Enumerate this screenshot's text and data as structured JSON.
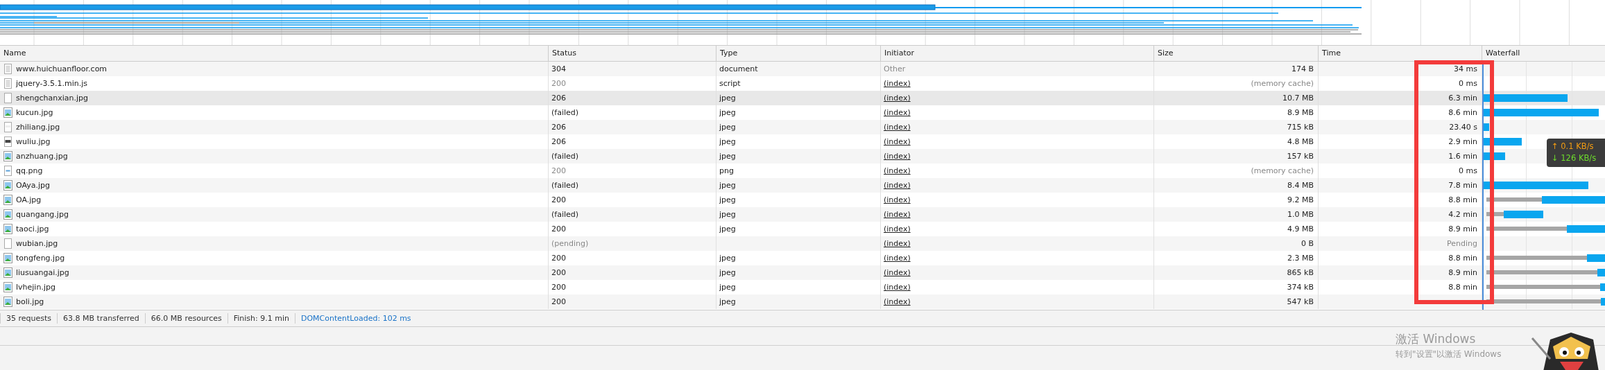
{
  "table": {
    "columns": [
      "Name",
      "Status",
      "Type",
      "Initiator",
      "Size",
      "Time",
      "Waterfall"
    ],
    "rows": [
      {
        "name": "www.huichuanfloor.com",
        "status": "304",
        "status_muted": false,
        "type": "document",
        "initiator": "Other",
        "initiator_link": false,
        "size": "174 B",
        "size_muted": false,
        "time": "34 ms",
        "time_muted": false,
        "selected": false
      },
      {
        "name": "jquery-3.5.1.min.js",
        "status": "200",
        "status_muted": true,
        "type": "script",
        "initiator": "(index)",
        "initiator_link": true,
        "size": "(memory cache)",
        "size_muted": true,
        "time": "0 ms",
        "time_muted": false,
        "selected": false
      },
      {
        "name": "shengchanxian.jpg",
        "status": "206",
        "status_muted": false,
        "type": "jpeg",
        "initiator": "(index)",
        "initiator_link": true,
        "size": "10.7 MB",
        "size_muted": false,
        "time": "6.3 min",
        "time_muted": false,
        "selected": true
      },
      {
        "name": "kucun.jpg",
        "status": "(failed)",
        "status_muted": false,
        "type": "jpeg",
        "initiator": "(index)",
        "initiator_link": true,
        "size": "8.9 MB",
        "size_muted": false,
        "time": "8.6 min",
        "time_muted": false,
        "selected": false
      },
      {
        "name": "zhiliang.jpg",
        "status": "206",
        "status_muted": false,
        "type": "jpeg",
        "initiator": "(index)",
        "initiator_link": true,
        "size": "715 kB",
        "size_muted": false,
        "time": "23.40 s",
        "time_muted": false,
        "selected": false
      },
      {
        "name": "wuliu.jpg",
        "status": "206",
        "status_muted": false,
        "type": "jpeg",
        "initiator": "(index)",
        "initiator_link": true,
        "size": "4.8 MB",
        "size_muted": false,
        "time": "2.9 min",
        "time_muted": false,
        "selected": false
      },
      {
        "name": "anzhuang.jpg",
        "status": "(failed)",
        "status_muted": false,
        "type": "jpeg",
        "initiator": "(index)",
        "initiator_link": true,
        "size": "157 kB",
        "size_muted": false,
        "time": "1.6 min",
        "time_muted": false,
        "selected": false
      },
      {
        "name": "qq.png",
        "status": "200",
        "status_muted": true,
        "type": "png",
        "initiator": "(index)",
        "initiator_link": true,
        "size": "(memory cache)",
        "size_muted": true,
        "time": "0 ms",
        "time_muted": false,
        "selected": false
      },
      {
        "name": "OAya.jpg",
        "status": "(failed)",
        "status_muted": false,
        "type": "jpeg",
        "initiator": "(index)",
        "initiator_link": true,
        "size": "8.4 MB",
        "size_muted": false,
        "time": "7.8 min",
        "time_muted": false,
        "selected": false
      },
      {
        "name": "OA.jpg",
        "status": "200",
        "status_muted": false,
        "type": "jpeg",
        "initiator": "(index)",
        "initiator_link": true,
        "size": "9.2 MB",
        "size_muted": false,
        "time": "8.8 min",
        "time_muted": false,
        "selected": false
      },
      {
        "name": "quangang.jpg",
        "status": "(failed)",
        "status_muted": false,
        "type": "jpeg",
        "initiator": "(index)",
        "initiator_link": true,
        "size": "1.0 MB",
        "size_muted": false,
        "time": "4.2 min",
        "time_muted": false,
        "selected": false
      },
      {
        "name": "taoci.jpg",
        "status": "200",
        "status_muted": false,
        "type": "jpeg",
        "initiator": "(index)",
        "initiator_link": true,
        "size": "4.9 MB",
        "size_muted": false,
        "time": "8.9 min",
        "time_muted": false,
        "selected": false
      },
      {
        "name": "wubian.jpg",
        "status": "(pending)",
        "status_muted": true,
        "initiator": "(index)",
        "initiator_link": true,
        "size": "0 B",
        "size_muted": false,
        "time": "Pending",
        "time_muted": true,
        "selected": false
      },
      {
        "name": "tongfeng.jpg",
        "status": "200",
        "status_muted": false,
        "type": "jpeg",
        "initiator": "(index)",
        "initiator_link": true,
        "size": "2.3 MB",
        "size_muted": false,
        "time": "8.8 min",
        "time_muted": false,
        "selected": false
      },
      {
        "name": "liusuangai.jpg",
        "status": "200",
        "status_muted": false,
        "type": "jpeg",
        "initiator": "(index)",
        "initiator_link": true,
        "size": "865 kB",
        "size_muted": false,
        "time": "8.9 min",
        "time_muted": false,
        "selected": false
      },
      {
        "name": "lvhejin.jpg",
        "status": "200",
        "status_muted": false,
        "type": "jpeg",
        "initiator": "(index)",
        "initiator_link": true,
        "size": "374 kB",
        "size_muted": false,
        "time": "8.8 min",
        "time_muted": false,
        "selected": false
      },
      {
        "name": "boli.jpg",
        "status": "200",
        "status_muted": false,
        "type": "jpeg",
        "initiator": "(index)",
        "initiator_link": true,
        "size": "547 kB",
        "size_muted": false,
        "selected": false
      }
    ]
  },
  "speed_tooltip": {
    "upload": "↑ 0.1 KB/s",
    "download": "↓ 126 KB/s"
  },
  "status_bar": {
    "items": [
      {
        "text": "35 requests",
        "kind": "summary"
      },
      {
        "text": "63.8 MB transferred",
        "kind": "summary"
      },
      {
        "text": "66.0 MB resources",
        "kind": "summary"
      },
      {
        "text": "Finish: 9.1 min",
        "kind": "summary"
      },
      {
        "text": "DOMContentLoaded: 102 ms",
        "kind": "event"
      }
    ]
  },
  "activation_notice": {
    "title": "激活 Windows",
    "message": "转到\"设置\"以激活 Windows"
  }
}
